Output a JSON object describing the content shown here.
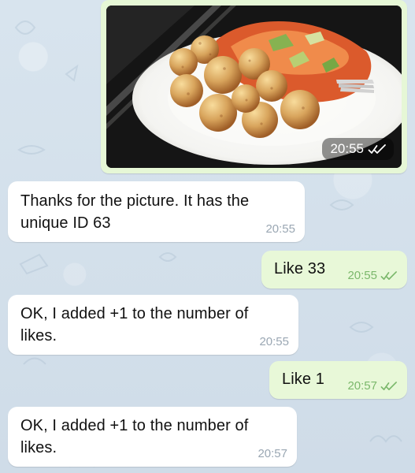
{
  "chat": {
    "photo": {
      "time": "20:55",
      "status_icon": "double-check-icon"
    },
    "messages": [
      {
        "side": "incoming",
        "text": "Thanks for the picture. It has the unique ID 63",
        "time": "20:55"
      },
      {
        "side": "outgoing",
        "text": "Like 33",
        "time": "20:55",
        "status_icon": "double-check-icon"
      },
      {
        "side": "incoming",
        "text": "OK, I added +1 to the number of likes.",
        "time": "20:55"
      },
      {
        "side": "outgoing",
        "text": "Like 1",
        "time": "20:57",
        "status_icon": "double-check-icon"
      },
      {
        "side": "incoming",
        "text": "OK, I added +1 to the number of likes.",
        "time": "20:57"
      }
    ]
  },
  "colors": {
    "wallpaper": "#d6e2ec",
    "incoming_bubble": "#ffffff",
    "outgoing_bubble": "#e8f8d8",
    "outgoing_meta": "#7bb86b"
  }
}
